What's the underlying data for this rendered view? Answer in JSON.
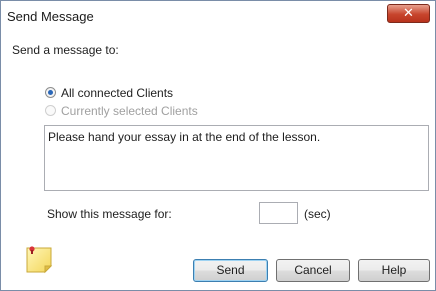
{
  "window": {
    "title": "Send Message",
    "close_glyph": "✕"
  },
  "recipients": {
    "heading": "Send a message to:",
    "options": [
      {
        "label": "All connected Clients",
        "selected": true,
        "enabled": true
      },
      {
        "label": "Currently selected Clients",
        "selected": false,
        "enabled": false
      }
    ]
  },
  "message": {
    "text": "Please hand your essay in at the end of the lesson."
  },
  "duration": {
    "label": "Show this message for:",
    "value": "",
    "unit": "(sec)"
  },
  "buttons": {
    "send": "Send",
    "cancel": "Cancel",
    "help": "Help"
  },
  "icons": {
    "note": "sticky-note-icon"
  },
  "colors": {
    "close_button": "#c7452d",
    "default_button_border": "#3c7fb1",
    "radio_dot": "#2a67b8"
  }
}
